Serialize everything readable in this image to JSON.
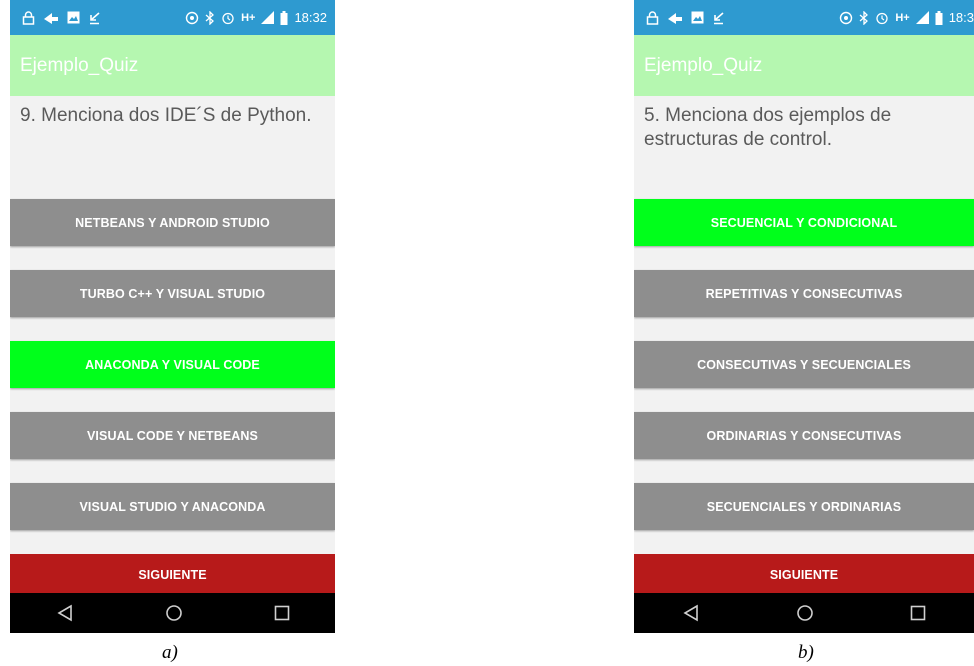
{
  "screens": [
    {
      "status_time": "18:32",
      "network": "H+",
      "app_title": "Ejemplo_Quiz",
      "question": "9. Menciona dos IDE´S de Python.",
      "options": [
        {
          "label": "NETBEANS Y ANDROID STUDIO",
          "state": "default"
        },
        {
          "label": "TURBO C++ Y VISUAL STUDIO",
          "state": "default"
        },
        {
          "label": "ANACONDA Y VISUAL CODE",
          "state": "correct"
        },
        {
          "label": "VISUAL CODE Y NETBEANS",
          "state": "default"
        },
        {
          "label": "VISUAL STUDIO Y ANACONDA",
          "state": "default"
        }
      ],
      "next_label": "SIGUIENTE",
      "caption": "a)"
    },
    {
      "status_time": "18:3",
      "network": "H+",
      "app_title": "Ejemplo_Quiz",
      "question": "5. Menciona dos ejemplos de estructuras de control.",
      "options": [
        {
          "label": "SECUENCIAL Y CONDICIONAL",
          "state": "correct"
        },
        {
          "label": "REPETITIVAS Y CONSECUTIVAS",
          "state": "default"
        },
        {
          "label": "CONSECUTIVAS Y SECUENCIALES",
          "state": "default"
        },
        {
          "label": "ORDINARIAS Y CONSECUTIVAS",
          "state": "default"
        },
        {
          "label": "SECUENCIALES Y ORDINARIAS",
          "state": "default"
        }
      ],
      "next_label": "SIGUIENTE",
      "caption": "b)"
    }
  ],
  "colors": {
    "status_bar": "#2e9ad0",
    "app_bar": "#b5f7b0",
    "option_default": "#8e8e8e",
    "option_correct": "#00ff1b",
    "next_button": "#b71a1a",
    "nav_bar": "#000000"
  },
  "icons": {
    "status_left": [
      "lock-icon",
      "signal-app-icon",
      "image-icon",
      "download-icon"
    ],
    "status_right": [
      "hotspot-icon",
      "bluetooth-icon",
      "alarm-icon",
      "signal-icon",
      "battery-icon"
    ],
    "nav": [
      "back-icon",
      "home-icon",
      "recents-icon"
    ]
  }
}
